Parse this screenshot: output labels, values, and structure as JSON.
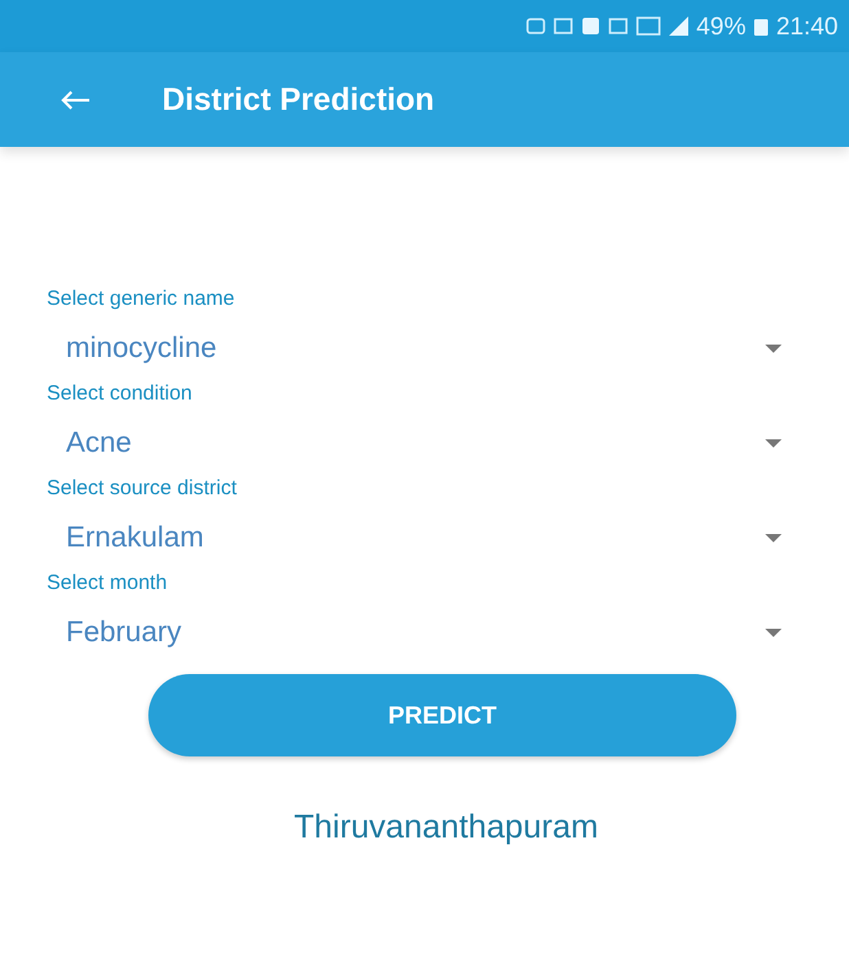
{
  "status_bar": {
    "battery": "49%",
    "time": "21:40"
  },
  "app_bar": {
    "title": "District Prediction"
  },
  "fields": [
    {
      "label": "Select generic name",
      "value": "minocycline"
    },
    {
      "label": "Select condition",
      "value": "Acne"
    },
    {
      "label": "Select source district",
      "value": "Ernakulam"
    },
    {
      "label": "Select month",
      "value": "February"
    }
  ],
  "predict_button": "PREDICT",
  "result": "Thiruvananthapuram"
}
